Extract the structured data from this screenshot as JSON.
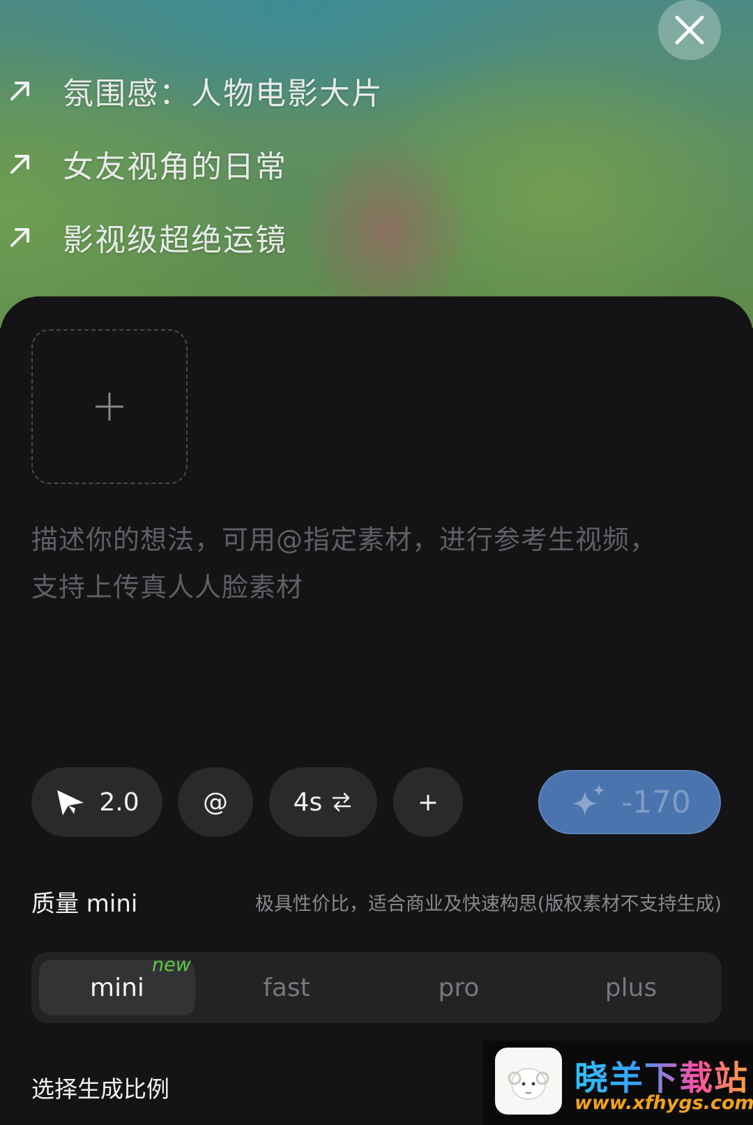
{
  "suggestions": [
    {
      "label": "氛围感：人物电影大片",
      "icon": "arrow-up-right-icon"
    },
    {
      "label": "女友视角的日常",
      "icon": "arrow-up-right-icon"
    },
    {
      "label": "影视级超绝运镜",
      "icon": "arrow-up-right-icon"
    }
  ],
  "prompt": {
    "placeholder_line1": "描述你的想法，可用@指定素材，进行参考生视频，",
    "placeholder_line2": "支持上传真人人脸素材"
  },
  "toolbar": {
    "model_version": "2.0",
    "mention_label": "@",
    "duration_label": "4s",
    "more_label": "+",
    "generate_cost": "-170"
  },
  "quality": {
    "title": "质量 mini",
    "description": "极具性价比，适合商业及快速构思(版权素材不支持生成)",
    "tabs": [
      "mini",
      "fast",
      "pro",
      "plus"
    ],
    "selected": "mini",
    "new_badge": "new"
  },
  "ratio": {
    "title": "选择生成比例"
  },
  "watermark": {
    "title": "晓羊下载站",
    "url": "www.xfhygs.com"
  },
  "colors": {
    "accent_blue": "#4a74ad",
    "new_badge_green": "#5bcb3f",
    "sheet_bg": "#141416"
  }
}
